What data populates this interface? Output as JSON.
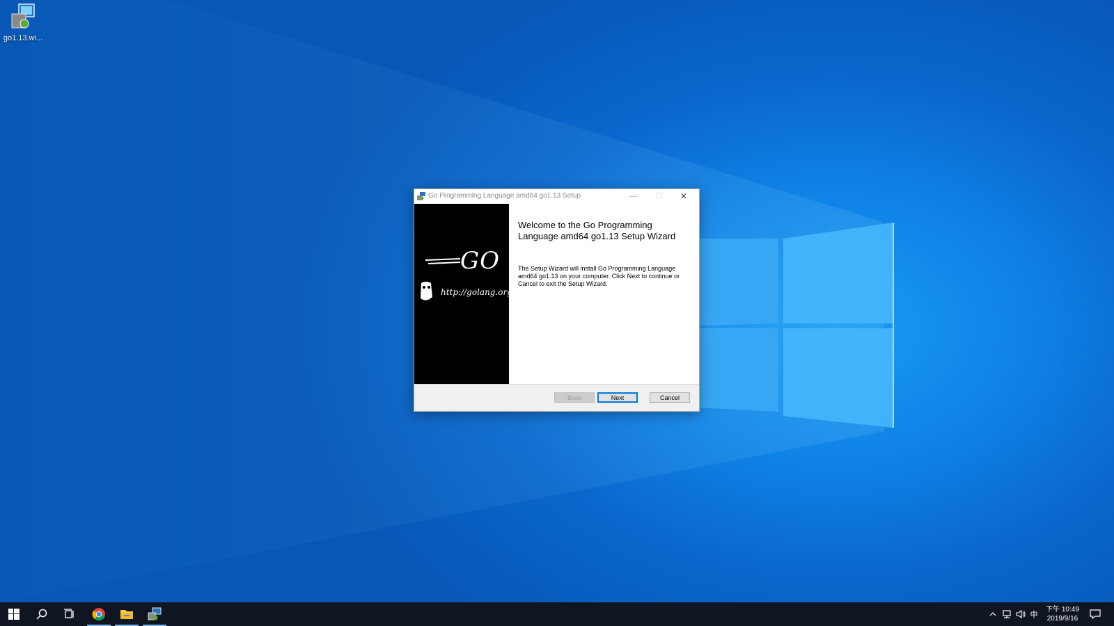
{
  "desktop": {
    "icons": [
      {
        "label": "go1.13.wi...",
        "icon": "msi-installer-icon"
      }
    ]
  },
  "window": {
    "title": "Go Programming Language amd64 go1.13 Setup",
    "minimize_glyph": "—",
    "maximize_glyph": "☐",
    "close_glyph": "✕",
    "banner": {
      "logo_text": "GO",
      "url_text": "http://golang.org"
    },
    "heading": "Welcome to the Go Programming Language amd64 go1.13 Setup Wizard",
    "description": "The Setup Wizard will install Go Programming Language amd64 go1.13 on your computer. Click Next to continue or Cancel to exit the Setup Wizard.",
    "buttons": {
      "back": "Back",
      "next": "Next",
      "cancel": "Cancel"
    }
  },
  "taskbar": {
    "items": [
      {
        "name": "start",
        "icon": "windows-start-icon"
      },
      {
        "name": "search",
        "icon": "search-icon"
      },
      {
        "name": "task-view",
        "icon": "task-view-icon"
      },
      {
        "name": "chrome",
        "icon": "chrome-icon",
        "active": true
      },
      {
        "name": "file-explorer",
        "icon": "folder-icon",
        "active": true
      },
      {
        "name": "installer",
        "icon": "msi-installer-icon",
        "active": true
      }
    ],
    "tray": {
      "chevron": "^",
      "ime": "中",
      "time": "下午 10:49",
      "date": "2019/9/16"
    }
  },
  "colors": {
    "accent": "#0078d7",
    "taskbar": "#101522",
    "desktop": "#0a66cc"
  }
}
